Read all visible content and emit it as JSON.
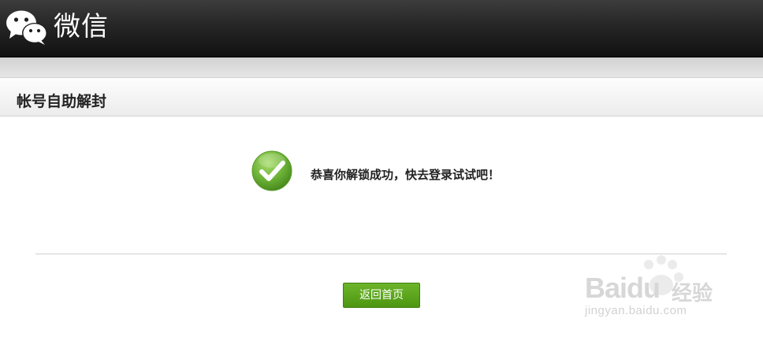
{
  "header": {
    "brand": "微信",
    "logo_icon": "wechat-logo-icon"
  },
  "section": {
    "title": "帐号自助解封"
  },
  "result": {
    "icon": "check-circle-icon",
    "message": "恭喜你解锁成功，快去登录试试吧！"
  },
  "actions": {
    "home_label": "返回首页"
  },
  "watermark": {
    "brand": "Baidu",
    "brand_cn": "经验",
    "url": "jingyan.baidu.com"
  },
  "colors": {
    "header_bg": "#1a1a1a",
    "button_green": "#5aa61c",
    "check_green": "#6cb236"
  }
}
